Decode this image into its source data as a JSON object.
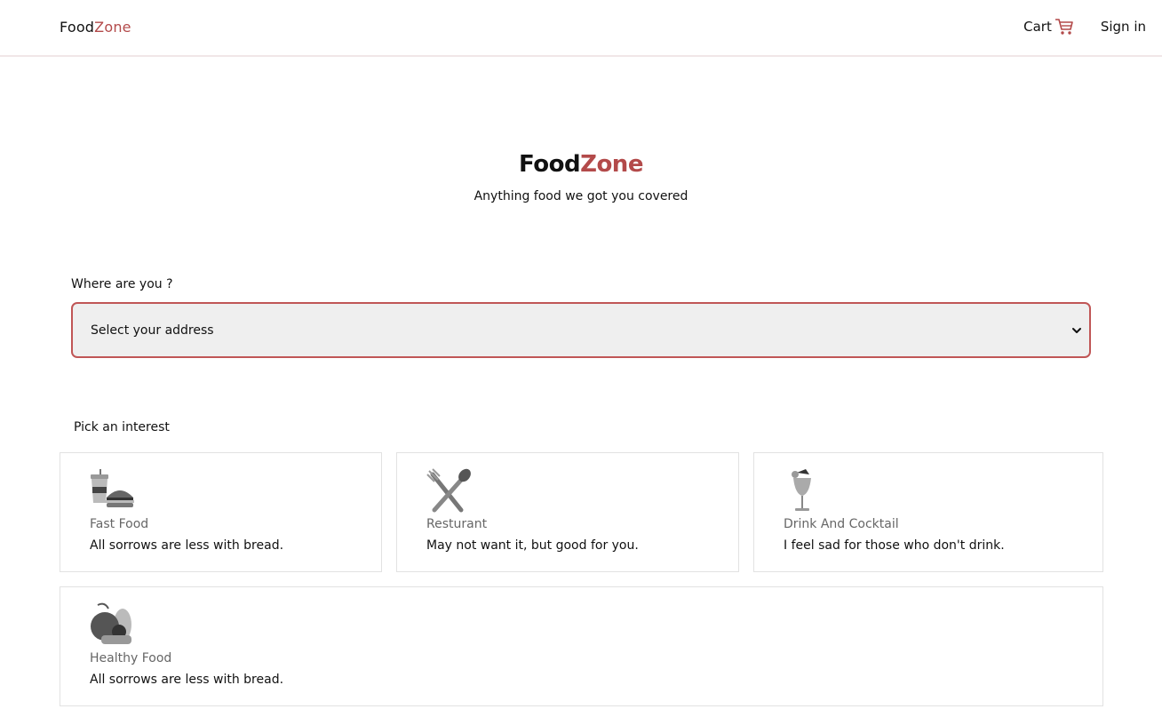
{
  "nav": {
    "brand_part1": "Food",
    "brand_part2": "Zone",
    "cart_label": "Cart",
    "cart_icon": "shopping-cart-icon",
    "signin_label": "Sign in"
  },
  "hero": {
    "title_part1": "Food",
    "title_part2": "Zone",
    "subtitle": "Anything food we got you covered"
  },
  "address": {
    "label": "Where are you ?",
    "selected": "Select your address"
  },
  "interests": {
    "label": "Pick an interest",
    "cards": [
      {
        "icon": "fast-food-icon",
        "category": "Fast Food",
        "quote": "All sorrows are less with bread."
      },
      {
        "icon": "fork-spoon-icon",
        "category": "Resturant",
        "quote": "May not want it, but good for you."
      },
      {
        "icon": "cocktail-icon",
        "category": "Drink And Cocktail",
        "quote": "I feel sad for those who don't drink."
      },
      {
        "icon": "healthy-food-icon",
        "category": "Healthy Food",
        "quote": "All sorrows are less with bread."
      }
    ]
  },
  "colors": {
    "accent": "#b34a4a",
    "select_border": "#c05656",
    "select_bg": "#efefef"
  }
}
